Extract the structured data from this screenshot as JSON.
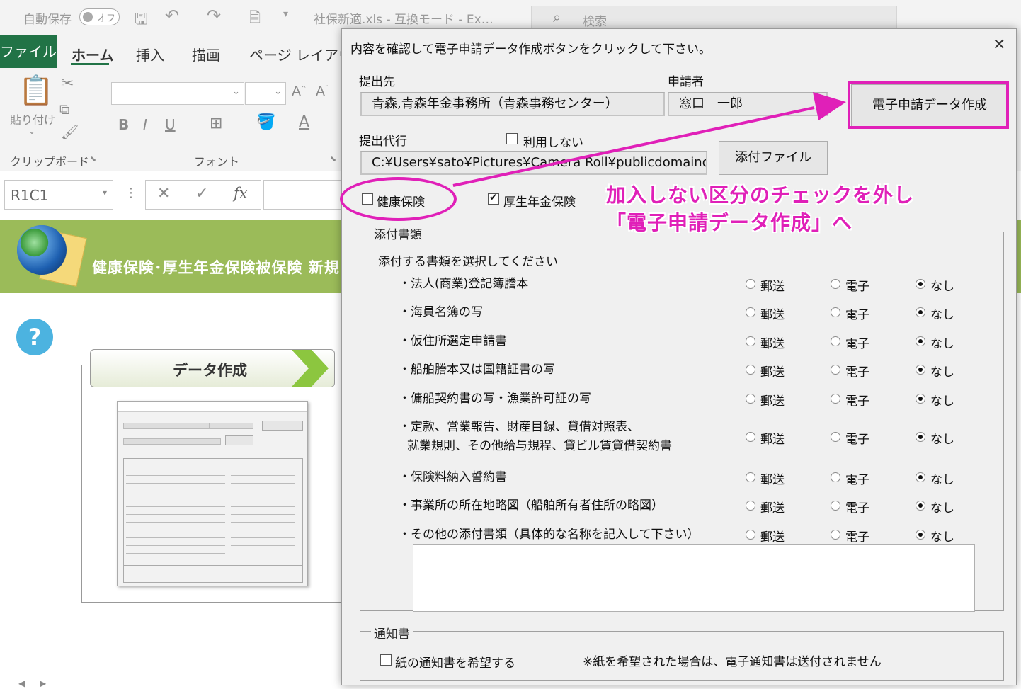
{
  "excel": {
    "autosave_label": "自動保存",
    "autosave_state": "オフ",
    "title": "社保新適.xls - 互換モード - Ex…",
    "search_placeholder": "検索",
    "tabs": [
      "ファイル",
      "ホーム",
      "挿入",
      "描画",
      "ページ レイアウト"
    ],
    "clipboard_paste": "貼り付け",
    "group_clipboard": "クリップボード",
    "group_font": "フォント",
    "name_box": "R1C1",
    "fx": "fx",
    "banner_title": "健康保険･厚生年金保険被保険 新規",
    "help_icon_char": "?",
    "data_button": "データ作成"
  },
  "dialog": {
    "title": "内容を確認して電子申請データ作成ボタンをクリックして下さい。",
    "close": "✕",
    "submit_to_label": "提出先",
    "submit_to_value": "青森,青森年金事務所（青森事務センター）",
    "applicant_label": "申請者",
    "applicant_value": "窓口　一郎",
    "create_button": "電子申請データ作成",
    "proxy_label": "提出代行",
    "proxy_unused_label": "利用しない",
    "proxy_unused_checked": false,
    "attachment_path": "C:¥Users¥sato¥Pictures¥Camera Roll¥publicdomainq-",
    "attach_file_button": "添付ファイル",
    "health_insurance_label": "健康保険",
    "health_insurance_checked": false,
    "pension_label": "厚生年金保険",
    "pension_checked": true,
    "attach_group_title": "添付書類",
    "attach_instruction": "添付する書類を選択してください",
    "radio_options": [
      "郵送",
      "電子",
      "なし"
    ],
    "documents": [
      {
        "name": "・法人(商業)登記簿謄本",
        "selected": "なし"
      },
      {
        "name": "・海員名簿の写",
        "selected": "なし"
      },
      {
        "name": "・仮住所選定申請書",
        "selected": "なし"
      },
      {
        "name": "・船舶謄本又は国籍証書の写",
        "selected": "なし"
      },
      {
        "name": "・傭船契約書の写・漁業許可証の写",
        "selected": "なし"
      },
      {
        "name": "・定款、営業報告、財産目録、貸借対照表、",
        "name2": "就業規則、その他給与規程、貸ビル賃貸借契約書",
        "selected": "なし"
      },
      {
        "name": "・保険料納入誓約書",
        "selected": "なし"
      },
      {
        "name": "・事業所の所在地略図（船舶所有者住所の略図）",
        "selected": "なし"
      },
      {
        "name": "・その他の添付書類（具体的な名称を記入して下さい）",
        "selected": "なし"
      }
    ],
    "other_docs_text": "",
    "notice_group_title": "通知書",
    "paper_notice_label": "紙の通知書を希望する",
    "paper_notice_checked": false,
    "paper_notice_note": "※紙を希望された場合は、電子通知書は送付されません"
  },
  "annotation": {
    "line1": "加入しない区分のチェックを外し",
    "line2": "「電子申請データ作成」へ",
    "color": "#e020b8"
  }
}
